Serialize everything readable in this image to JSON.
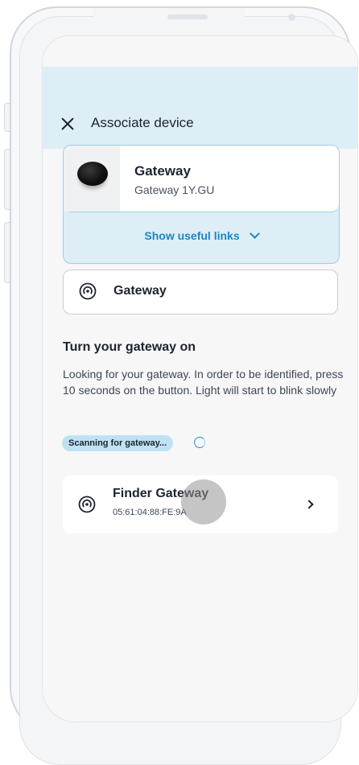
{
  "header": {
    "title": "Associate device"
  },
  "device": {
    "name": "Gateway",
    "model": "Gateway 1Y.GU",
    "links_label": "Show useful links",
    "image": "gateway-puck"
  },
  "gateway_option": {
    "label": "Gateway",
    "icon": "broadcast-icon"
  },
  "instructions": {
    "title": "Turn your gateway on",
    "text": "Looking for your gateway. In order to be identified, press 10 seconds on the button. Light will start to blink slowly"
  },
  "scan": {
    "badge": "Scanning for gateway..."
  },
  "found_device": {
    "name": "Finder Gateway",
    "mac": "05:61:04:88:FE:9A",
    "icon": "broadcast-icon"
  },
  "colors": {
    "header_bg": "#ddeef6",
    "accent": "#1a86c3",
    "badge_bg": "#bfe2f3"
  }
}
